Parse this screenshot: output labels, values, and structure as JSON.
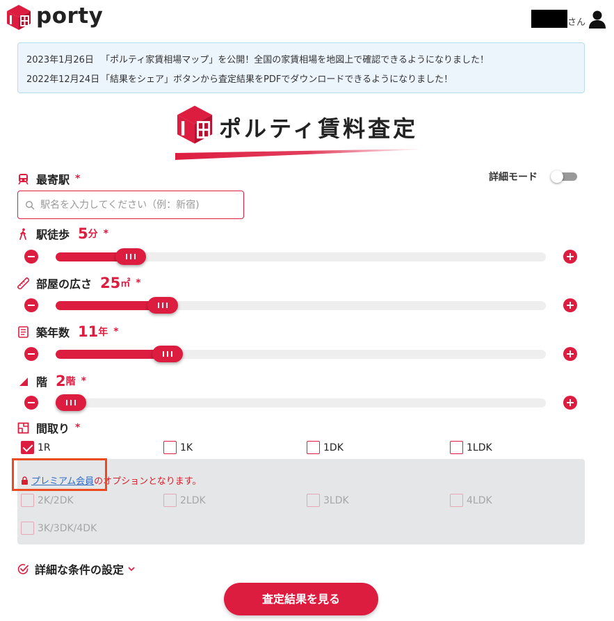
{
  "header": {
    "logo_text": "porty",
    "user_suffix": "さん",
    "icons": {
      "logo": "porty-logo-icon",
      "user": "user-icon"
    }
  },
  "notices": [
    {
      "date": "2023年1月26日",
      "text": "「ポルティ家賃相場マップ」を公開！全国の家賃相場を地図上で確認できるようになりました！"
    },
    {
      "date": "2022年12月24日",
      "text": "「結果をシェア」ボタンから査定結果をPDFでダウンロードできるようになりました！"
    }
  ],
  "brand": {
    "title": "ポルティ賃料査定"
  },
  "station": {
    "label": "最寄駅",
    "required_mark": "*",
    "placeholder": "駅名を入力してください（例：新宿)",
    "value": ""
  },
  "detail_mode": {
    "label": "詳細モード",
    "enabled": false
  },
  "walk": {
    "label": "駅徒歩",
    "value": "5",
    "unit": "分",
    "required_mark": "*",
    "level": 0.13
  },
  "area": {
    "label": "部屋の広さ",
    "value": "25",
    "unit": "㎡",
    "required_mark": "*",
    "level": 0.2
  },
  "age": {
    "label": "築年数",
    "value": "11",
    "unit": "年",
    "required_mark": "*",
    "level": 0.21
  },
  "floor": {
    "label": "階",
    "value": "2",
    "unit": "階",
    "required_mark": "*",
    "level": 0.0
  },
  "layout": {
    "label": "間取り",
    "required_mark": "*",
    "options": [
      {
        "label": "1R",
        "checked": true
      },
      {
        "label": "1K",
        "checked": false
      },
      {
        "label": "1DK",
        "checked": false
      },
      {
        "label": "1LDK",
        "checked": false
      }
    ],
    "premium_link": "プレミアム会員",
    "premium_suffix": "のオプションとなります。",
    "premium_options": [
      "2K/2DK",
      "2LDK",
      "3LDK",
      "4LDK",
      "3K/3DK/4DK"
    ]
  },
  "advanced": {
    "label": "詳細な条件の設定"
  },
  "submit": {
    "label": "査定結果を見る"
  },
  "colors": {
    "accent": "#dd1d40",
    "notice_bg": "#ecf5fc",
    "premium_bg": "#e5e6e8",
    "highlight_border": "#ed4a1f",
    "link": "#2f6cc4"
  }
}
